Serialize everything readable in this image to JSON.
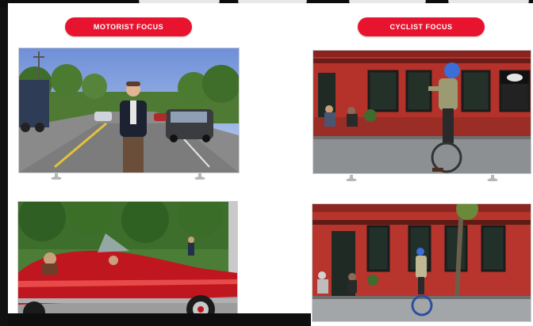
{
  "sections": {
    "motorist": {
      "label": "MOTORIST FOCUS"
    },
    "cyclist": {
      "label": "CYCLIST FOCUS"
    }
  },
  "colors": {
    "accent": "#e8132f",
    "canvas": "#ffffff",
    "frame": "#111111"
  },
  "videos": [
    {
      "name": "motorist-road-presenter-video"
    },
    {
      "name": "cyclist-unicycle-storefront-video"
    },
    {
      "name": "motorist-red-convertible-video"
    },
    {
      "name": "cyclist-unicycle-street-video"
    }
  ]
}
